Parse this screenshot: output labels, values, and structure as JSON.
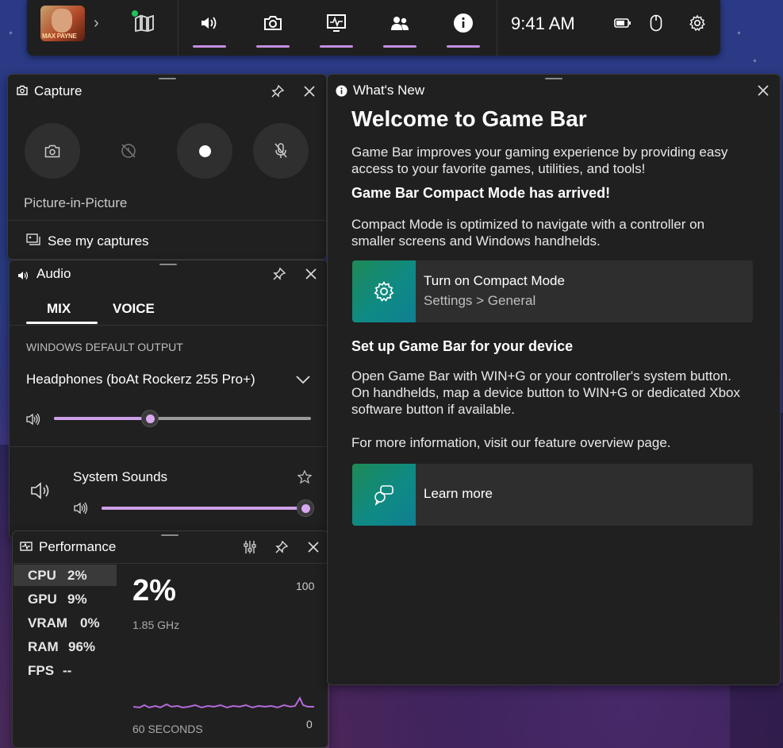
{
  "topbar": {
    "game_logo_text": "MAX PAYNE",
    "time": "9:41 AM"
  },
  "capture": {
    "title": "Capture",
    "pip_label": "Picture-in-Picture",
    "see_captures": "See my captures"
  },
  "audio": {
    "title": "Audio",
    "tabs": [
      {
        "label": "MIX"
      },
      {
        "label": "VOICE"
      }
    ],
    "output_heading": "WINDOWS DEFAULT OUTPUT",
    "device": "Headphones (boAt Rockerz 255 Pro+)",
    "device_volume": 0.37,
    "app_name": "System Sounds",
    "app_volume": 1.0
  },
  "performance": {
    "title": "Performance",
    "stats": [
      {
        "name": "CPU",
        "value": "2%"
      },
      {
        "name": "GPU",
        "value": "9%"
      },
      {
        "name": "VRAM",
        "value": "0%"
      },
      {
        "name": "RAM",
        "value": "96%"
      },
      {
        "name": "FPS",
        "value": "--"
      }
    ],
    "big_value": "2%",
    "freq": "1.85 GHz",
    "max_label": "100",
    "min_label": "0",
    "time_label": "60 SECONDS"
  },
  "whats_new": {
    "title": "What's New",
    "heading": "Welcome to Game Bar",
    "intro_1": "Game Bar improves your gaming experience by providing easy",
    "intro_2": "access to your favorite games, utilities, and tools!",
    "sub1": "Game Bar Compact Mode has arrived!",
    "p2_1": "Compact Mode is optimized to navigate with a controller on",
    "p2_2": "smaller screens and Windows handhelds.",
    "card1_title": "Turn on Compact Mode",
    "card1_sub": "Settings > General",
    "sub2": "Set up Game Bar for your device",
    "p3_1": "Open Game Bar with WIN+G or your controller's system button.",
    "p3_2": "On handhelds, map a device button to WIN+G or dedicated Xbox",
    "p3_3": "software button if available.",
    "p4": "For more information, visit our feature overview page.",
    "card2_title": "Learn more"
  },
  "colors": {
    "accent": "#c48ddf",
    "panel": "#202020",
    "card_gradient_start": "#1e8a57",
    "card_gradient_end": "#0f7f92"
  }
}
